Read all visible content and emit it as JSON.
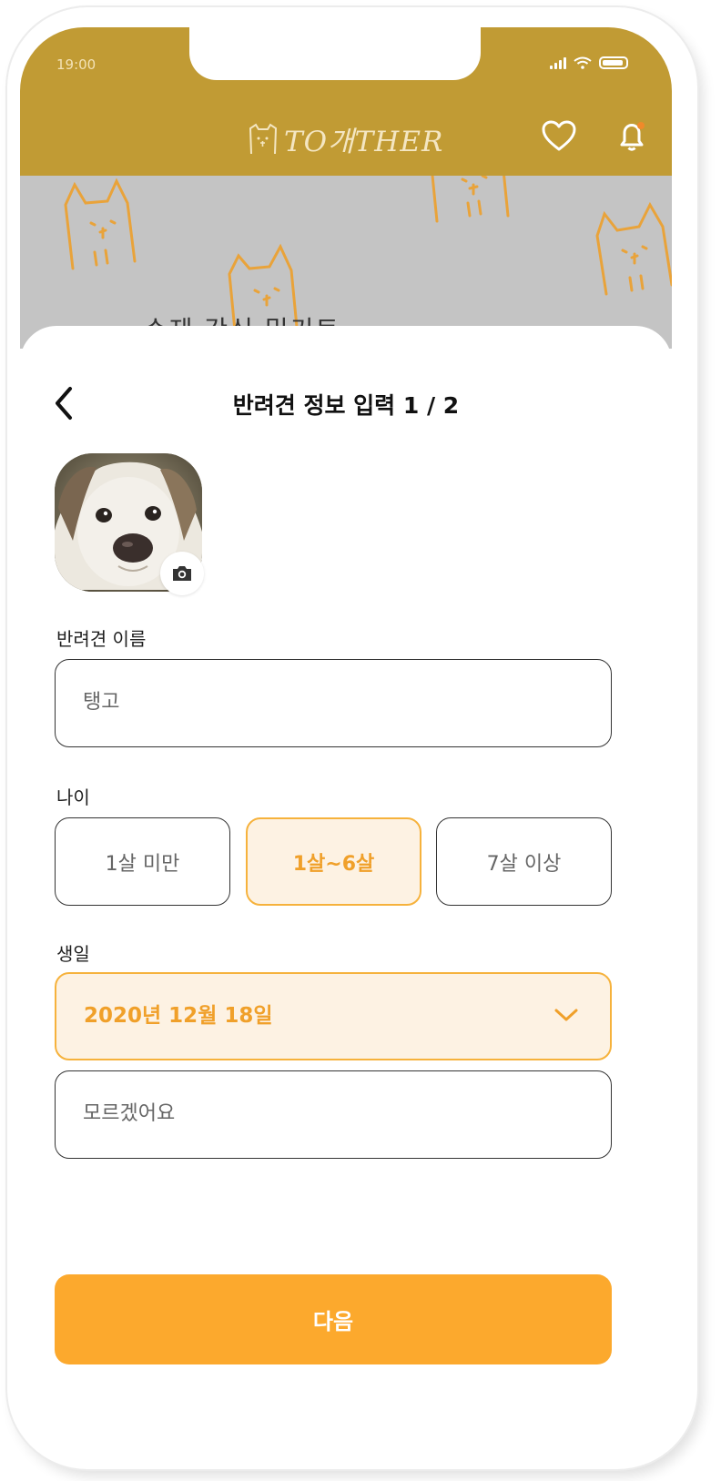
{
  "status_bar": {
    "time": "19:00"
  },
  "header": {
    "logo_text": "TO개THER"
  },
  "backdrop": {
    "title": "수제 간식 밀키트"
  },
  "form": {
    "title": "반려견 정보 입력 1 / 2",
    "name_label": "반려견 이름",
    "name_value": "탱고",
    "age_label": "나이",
    "age_options": [
      "1살 미만",
      "1살~6살",
      "7살 이상"
    ],
    "age_selected": "1살~6살",
    "birthday_label": "생일",
    "birthday_value": "2020년 12월 18일",
    "unknown_label": "모르겠어요",
    "next_label": "다음"
  },
  "colors": {
    "header": "#c19b34",
    "accent": "#fca92d",
    "selected_bg": "#fdf2e3",
    "doodle": "#e9a33a"
  }
}
